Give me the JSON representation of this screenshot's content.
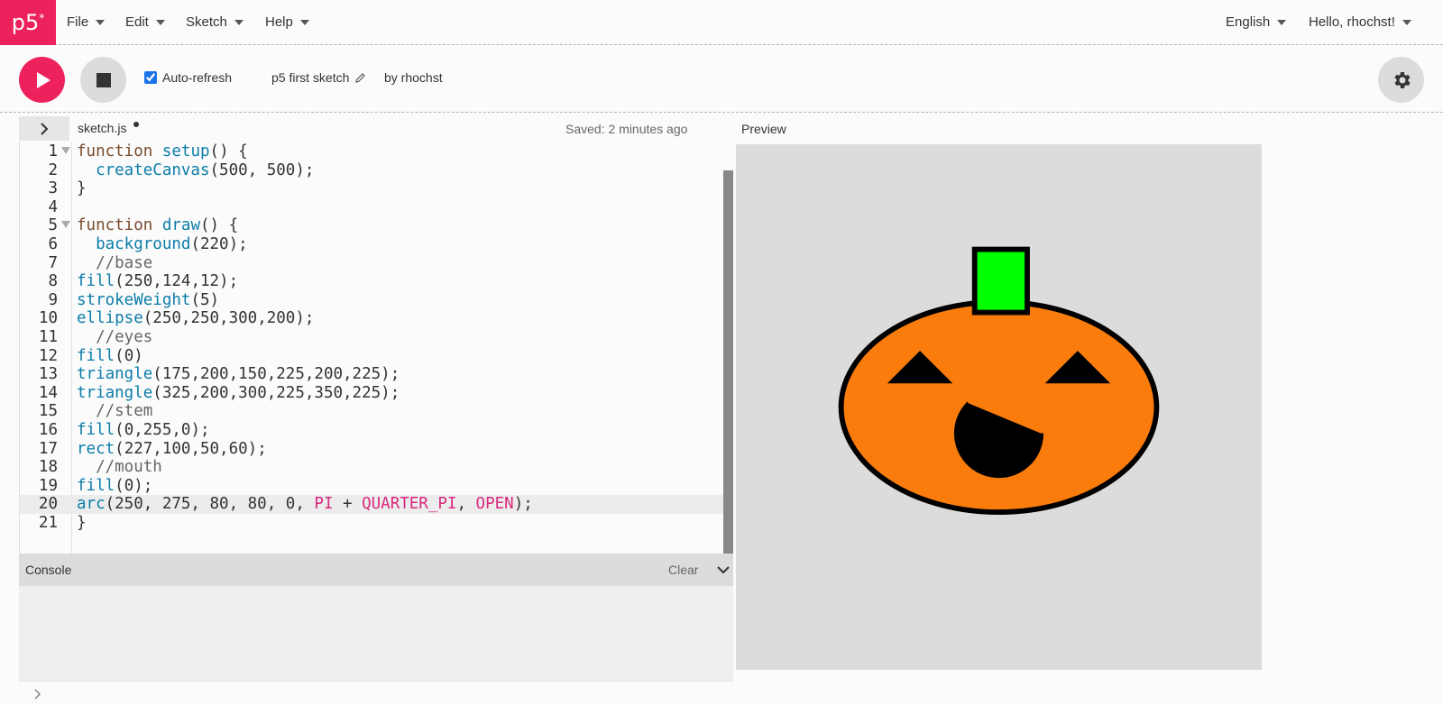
{
  "nav": {
    "logo": "p5",
    "logo_sup": "*",
    "menu": [
      "File",
      "Edit",
      "Sketch",
      "Help"
    ],
    "language": "English",
    "greeting": "Hello, rhochst!"
  },
  "toolbar": {
    "autorefresh_label": "Auto-refresh",
    "autorefresh_checked": true,
    "sketch_name": "p5 first sketch",
    "by_label": "by rhochst"
  },
  "editor": {
    "filename": "sketch.js",
    "saved_status": "Saved: 2 minutes ago",
    "preview_label": "Preview",
    "lines": [
      "function setup() {",
      "  createCanvas(500, 500);",
      "}",
      "",
      "function draw() {",
      "  background(220);",
      "  //base",
      "fill(250,124,12);",
      "strokeWeight(5)",
      "ellipse(250,250,300,200);",
      "  //eyes",
      "fill(0)",
      "triangle(175,200,150,225,200,225);",
      "triangle(325,200,300,225,350,225);",
      "  //stem",
      "fill(0,255,0);",
      "rect(227,100,50,60);",
      "  //mouth",
      "fill(0);",
      "arc(250, 275, 80, 80, 0, PI + QUARTER_PI, OPEN);",
      "}"
    ],
    "active_line": 20
  },
  "console": {
    "title": "Console",
    "clear_label": "Clear",
    "prompt": ">"
  },
  "colors": {
    "brand": "#ed225d",
    "pumpkin": "#fa7c0c",
    "stem": "#00ff00",
    "canvas_bg": "#dcdcdc"
  }
}
